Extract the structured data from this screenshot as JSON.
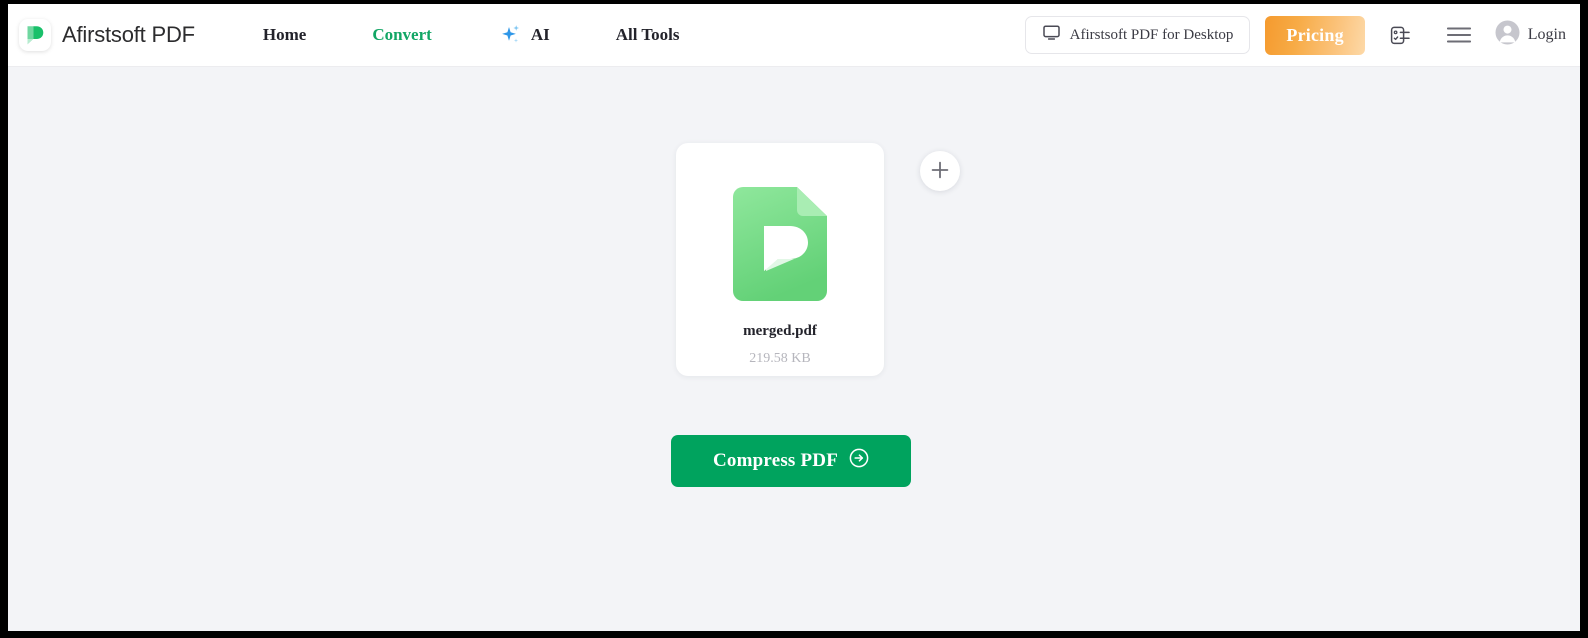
{
  "header": {
    "brand_name": "Afirstsoft PDF",
    "logo_icon": "afirstsoft-leaf-logo",
    "nav": [
      {
        "label": "Home",
        "active": false,
        "icon": null
      },
      {
        "label": "Convert",
        "active": true,
        "icon": null
      },
      {
        "label": "AI",
        "active": false,
        "icon": "sparkle-icon"
      },
      {
        "label": "All Tools",
        "active": false,
        "icon": null
      }
    ],
    "desktop_button": {
      "label": "Afirstsoft PDF for Desktop",
      "icon": "monitor-icon"
    },
    "pricing_button": {
      "label": "Pricing"
    },
    "task_list_icon": "checklist-icon",
    "menu_icon": "hamburger-menu-icon",
    "login": {
      "label": "Login",
      "icon": "user-avatar-icon"
    }
  },
  "main": {
    "file": {
      "name": "merged.pdf",
      "size": "219.58 KB",
      "icon": "pdf-file-icon"
    },
    "add_file_icon": "plus-icon",
    "action_button": {
      "label": "Compress PDF",
      "icon": "arrow-right-circle-icon"
    }
  },
  "colors": {
    "accent_green": "#12a665",
    "button_green": "#00a35e",
    "pricing_orange": "#f59a2e",
    "page_background": "#f3f4f7",
    "header_background": "#ffffff",
    "pdf_icon_green": "#7ddc8b"
  }
}
